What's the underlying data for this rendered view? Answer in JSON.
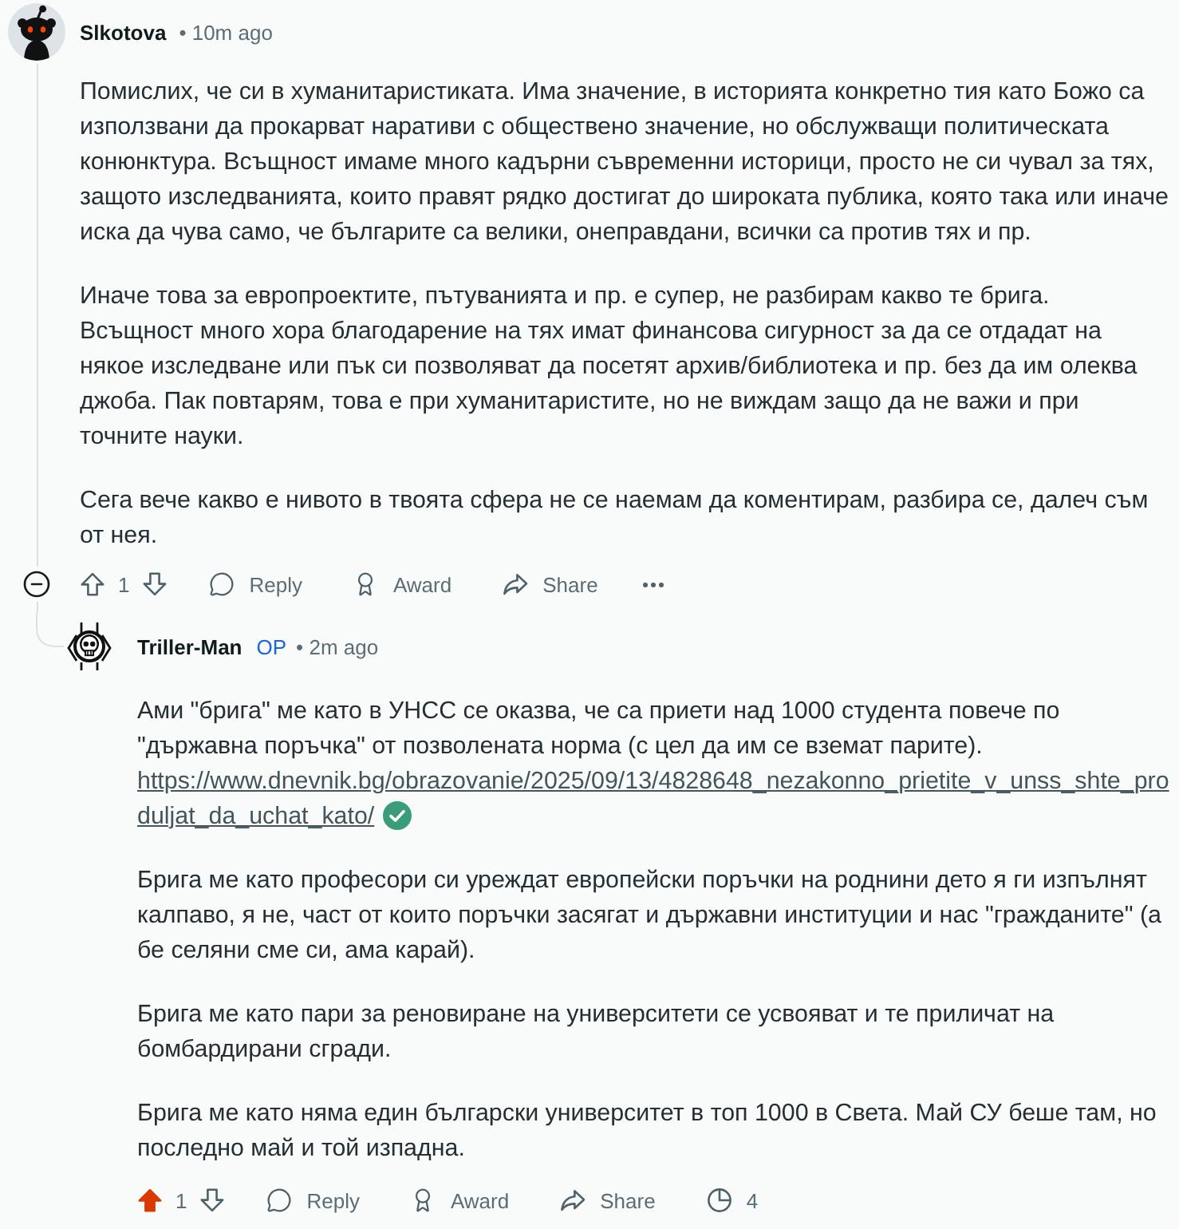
{
  "comments": [
    {
      "author": "Slkotova",
      "avatar": {
        "kind": "alien"
      },
      "time_text": "• 10m ago",
      "expanded": true,
      "paragraphs": [
        {
          "text": "Помислих, че си в хуманитаристиката. Има значение, в историята конкретно тия като Божо са използвани да прокарват наративи с обществено значение, но обслужващи политическата конюнктура. Всъщност имаме много кадърни съвременни историци, просто не си чувал за тях, защото изследванията, които правят рядко достигат до широката публика, която така или иначе иска да чува само, че българите са велики, онеправдани, всички са против тях и пр."
        },
        {
          "text": "Иначе това за европроектите, пътуванията и пр. е супер, не разбирам какво те брига. Всъщност много хора благодарение на тях имат финансова сигурност за да се отдадат на някое изследване или пък си позволяват да посетят архив/библиотека и пр. без да им олеква джоба. Пак повтарям, това е при хуманитаристите, но не виждам защо да не важи и при точните науки."
        },
        {
          "text": "Сега вече какво е нивото в твоята сфера не се наемам да коментирам, разбира се, далеч съм от нея."
        }
      ],
      "vote": {
        "score": "1",
        "upvoted": false
      },
      "actions": [
        {
          "kind": "reply",
          "label": "Reply"
        },
        {
          "kind": "award",
          "label": "Award"
        },
        {
          "kind": "share",
          "label": "Share"
        },
        {
          "kind": "more"
        }
      ],
      "replies": [
        {
          "author": "Triller-Man",
          "badge": "OP",
          "avatar": {
            "kind": "skull"
          },
          "time_text": "• 2m ago",
          "paragraphs": [
            {
              "text": "Ами \"брига\" ме като в УНСС се оказва, че са приети над 1000 студента повече по \"държавна поръчка\" от позволената норма (с цел да им се вземат парите).",
              "link": "https://www.dnevnik.bg/obrazovanie/2025/09/13/4828648_nezakonno_prietite_v_unss_shte_produljat_da_uchat_kato/",
              "link_verified": true
            },
            {
              "text": "Брига ме като професори си уреждат европейски поръчки на роднини дето я ги изпълнят калпаво, я не, част от които поръчки засягат и държавни институции и нас \"гражданите\" (а бе селяни сме си, ама карай)."
            },
            {
              "text": "Брига ме като пари за реновиране на университети се усвояват и те приличат на бомбардирани сгради."
            },
            {
              "text": "Брига ме като няма един български университет в топ 1000 в Света. Май СУ беше там, но последно май и той изпадна."
            }
          ],
          "vote": {
            "score": "1",
            "upvoted": true
          },
          "actions": [
            {
              "kind": "reply",
              "label": "Reply"
            },
            {
              "kind": "award",
              "label": "Award"
            },
            {
              "kind": "share",
              "label": "Share"
            },
            {
              "kind": "insights",
              "label": "4"
            }
          ]
        }
      ]
    }
  ]
}
